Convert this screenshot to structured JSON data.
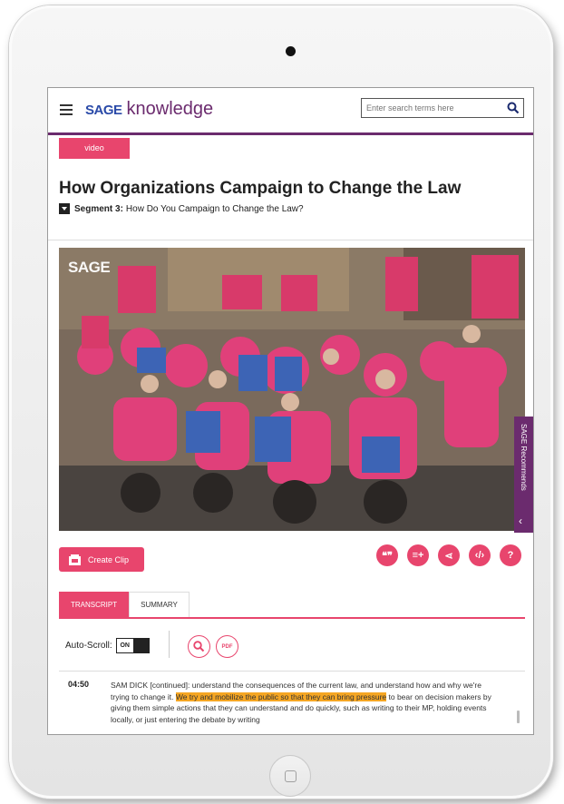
{
  "header": {
    "logo_mark": "SAGE",
    "logo_text": "knowledge",
    "search_placeholder": "Enter search terms here"
  },
  "badge": "video",
  "title": "How Organizations Campaign to Change the Law",
  "segment": {
    "label": "Segment 3:",
    "text": "How Do You Campaign to Change the Law?"
  },
  "video": {
    "watermark": "SAGE"
  },
  "side_tab": "SAGE Recommends",
  "create_clip": "Create Clip",
  "actions": [
    {
      "name": "cite",
      "glyph": "❝❞"
    },
    {
      "name": "add-to-list",
      "glyph": "≡+"
    },
    {
      "name": "share",
      "glyph": "⋖"
    },
    {
      "name": "embed",
      "glyph": "‹/›"
    },
    {
      "name": "help",
      "glyph": "?"
    }
  ],
  "tabs": [
    {
      "label": "TRANSCRIPT",
      "active": true
    },
    {
      "label": "SUMMARY",
      "active": false
    }
  ],
  "toolbar": {
    "autoscroll_label": "Auto-Scroll:",
    "toggle_state": "ON",
    "pdf_label": "PDF"
  },
  "transcript": {
    "timestamp": "04:50",
    "before": "SAM DICK [continued]: understand the consequences of the current law, and understand how and why we're trying to change it. ",
    "highlight": "We try and mobilize the public so that they can bring pressure",
    "after": " to bear on decision makers by giving them simple actions that they can understand and do quickly, such as writing to their MP, holding events locally, or just entering the debate by writing"
  },
  "colors": {
    "accent": "#e8456d",
    "brand": "#6b2b6e",
    "highlight": "#f5a623"
  }
}
